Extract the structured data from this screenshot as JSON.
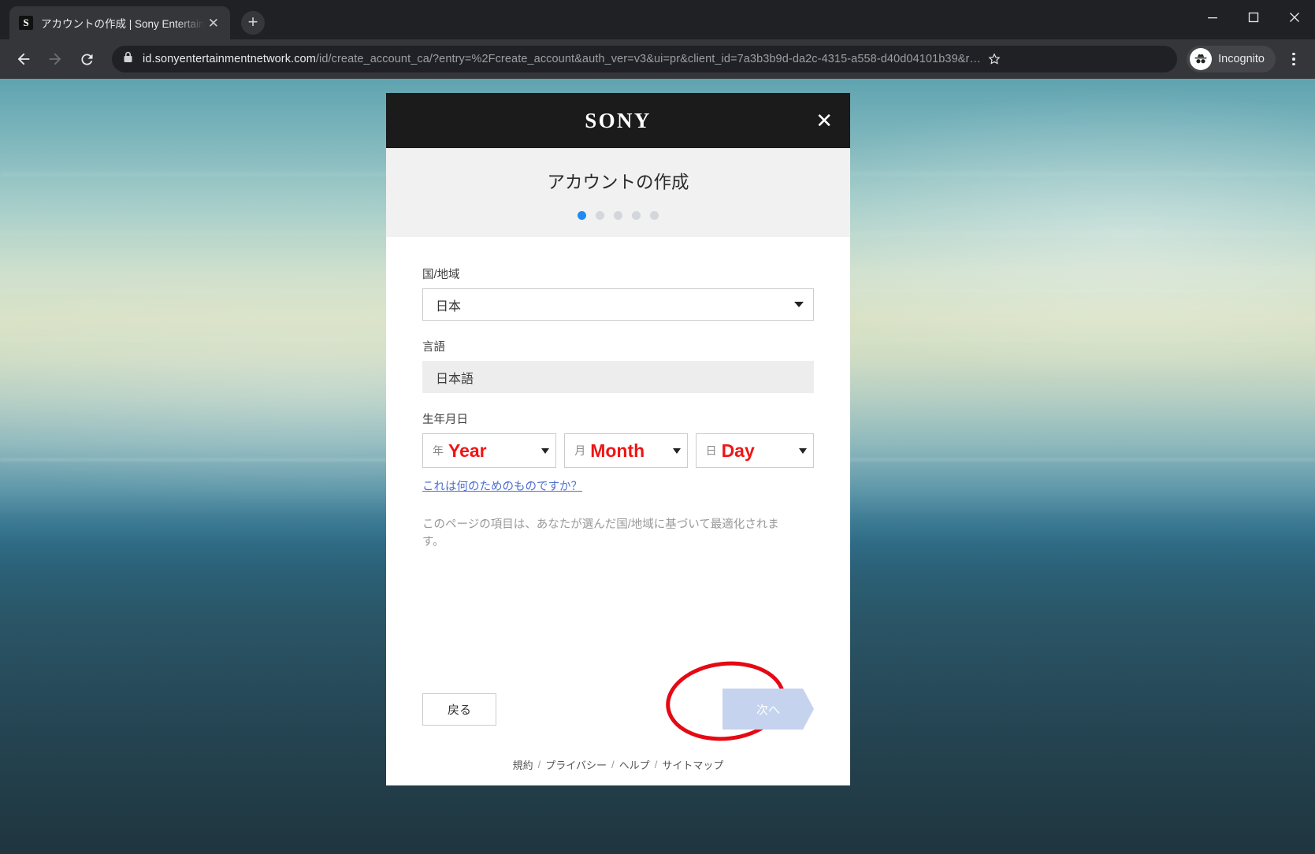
{
  "browser": {
    "tab": {
      "favicon_letter": "S",
      "title": "アカウントの作成 | Sony Entertainm",
      "close_icon": "close-icon"
    },
    "newtab_label": "+",
    "window_controls": [
      "minimize",
      "maximize",
      "close"
    ],
    "nav": {
      "back": "back-arrow",
      "forward": "forward-arrow",
      "reload": "reload-icon"
    },
    "omnibox": {
      "lock_icon": "lock-icon",
      "host": "id.sonyentertainmentnetwork.com",
      "path": "/id/create_account_ca/?entry=%2Fcreate_account&auth_ver=v3&ui=pr&client_id=7a3b3b9d-da2c-4315-a558-d40d04101b39&r…",
      "star_icon": "star-icon"
    },
    "profile": {
      "label": "Incognito",
      "icon": "incognito-icon"
    },
    "menu_icon": "kebab-menu-icon"
  },
  "modal": {
    "brand": "SONY",
    "close_label": "✕",
    "title": "アカウントの作成",
    "steps": {
      "count": 5,
      "active_index": 0,
      "active_color": "#1d8bf1",
      "inactive_color": "#d3d6da"
    },
    "fields": {
      "country": {
        "label": "国/地域",
        "value": "日本"
      },
      "language": {
        "label": "言語",
        "value": "日本語"
      },
      "dob": {
        "label": "生年月日",
        "year": {
          "unit": "年",
          "value": "Year"
        },
        "month": {
          "unit": "月",
          "value": "Month"
        },
        "day": {
          "unit": "日",
          "value": "Day"
        },
        "value_color": "#f01414"
      }
    },
    "why_link": "これは何のためのものですか？",
    "note": "このページの項目は、あなたが選んだ国/地域に基づいて最適化されます。",
    "buttons": {
      "back": "戻る",
      "next": "次へ"
    },
    "annotation": {
      "shape": "ellipse",
      "color": "#e50914",
      "target": "next-button"
    },
    "footer_links": [
      "規約",
      "プライバシー",
      "ヘルプ",
      "サイトマップ"
    ],
    "footer_separator": "/"
  }
}
